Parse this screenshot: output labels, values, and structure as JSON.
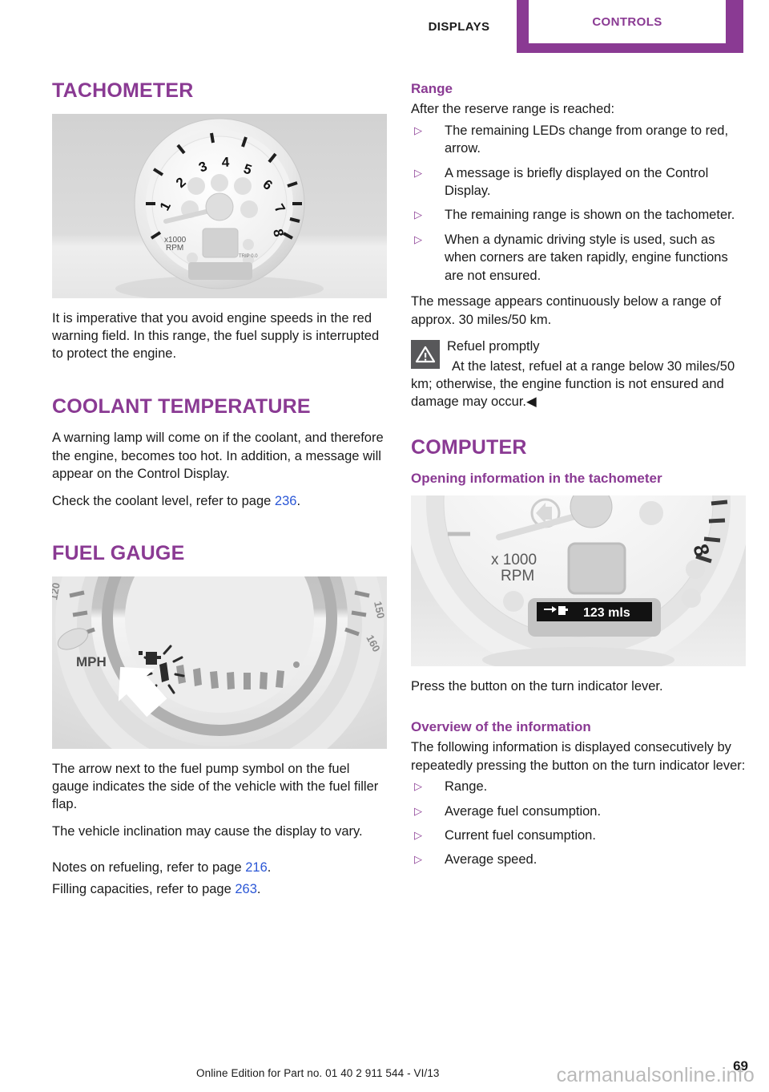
{
  "header": {
    "tab_displays": "DISPLAYS",
    "tab_controls": "CONTROLS",
    "accent_color": "#8a3a93"
  },
  "left_column": {
    "tachometer": {
      "heading": "TACHOMETER",
      "figure_caption_alt": "Tachometer gauge with x1000 RPM dial",
      "figure_labels": {
        "scale": "x1000",
        "unit": "RPM",
        "ticks": [
          "1",
          "2",
          "3",
          "4",
          "5",
          "6",
          "7",
          "8"
        ],
        "trip": "TRIP 0.0"
      },
      "paragraph": "It is imperative that you avoid engine speeds in the red warning field. In this range, the fuel supply is interrupted to protect the engine."
    },
    "coolant": {
      "heading": "COOLANT TEMPERATURE",
      "paragraph": "A warning lamp will come on if the coolant, and therefore the engine, becomes too hot. In addition, a message will appear on the Control Display.",
      "refer_prefix": "Check the coolant level, refer to page ",
      "refer_page": "236",
      "refer_suffix": "."
    },
    "fuel_gauge": {
      "heading": "FUEL GAUGE",
      "figure_labels": {
        "unit": "MPH",
        "ticks": [
          "120",
          "150",
          "160"
        ]
      },
      "paragraph_1": "The arrow next to the fuel pump symbol on the fuel gauge indicates the side of the vehicle with the fuel filler flap.",
      "paragraph_2": "The vehicle inclination may cause the display to vary.",
      "refer_1_prefix": "Notes on refueling, refer to page ",
      "refer_1_page": "216",
      "refer_1_suffix": ".",
      "refer_2_prefix": "Filling capacities, refer to page ",
      "refer_2_page": "263",
      "refer_2_suffix": "."
    }
  },
  "right_column": {
    "range": {
      "heading": "Range",
      "intro": "After the reserve range is reached:",
      "bullets": [
        "The remaining LEDs change from orange to red, arrow.",
        "A message is briefly displayed on the Control Display.",
        "The remaining range is shown on the tachometer.",
        "When a dynamic driving style is used, such as when corners are taken rapidly, engine functions are not ensured."
      ],
      "closing": "The message appears continuously below a range of approx. 30 miles/50 km."
    },
    "warning_note": {
      "icon": "warning-triangle-icon",
      "title": "Refuel promptly",
      "text": "At the latest, refuel at a range below 30 miles/50 km; otherwise, the engine function is not ensured and damage may occur.",
      "end_marker": "◀"
    },
    "computer": {
      "heading": "COMPUTER",
      "sub_heading": "Opening information in the tachometer",
      "figure_labels": {
        "scale": "x1000",
        "unit": "RPM",
        "display_value": "123 mls",
        "tick": "8"
      },
      "caption": "Press the button on the turn indicator lever."
    },
    "overview": {
      "heading": "Overview of the information",
      "intro": "The following information is displayed consecutively by repeatedly pressing the button on the turn indicator lever:",
      "bullets": [
        "Range.",
        "Average fuel consumption.",
        "Current fuel consumption.",
        "Average speed."
      ]
    }
  },
  "footer": {
    "edition": "Online Edition for Part no. 01 40 2 911 544 - VI/13",
    "page_number": "69",
    "watermark": "carmanualsonline.info"
  }
}
